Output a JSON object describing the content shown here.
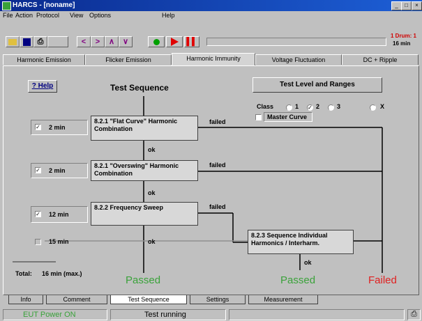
{
  "window": {
    "title": "HARCS - [noname]"
  },
  "menu": [
    "File",
    "Action",
    "Protocol",
    "View",
    "Options",
    "Help"
  ],
  "toolbar": {
    "status_lines": [
      "1 Drum: 1",
      "16   min"
    ],
    "record_color": "#00a000",
    "play_color": "#e00000"
  },
  "top_tabs": [
    "Harmonic Emission",
    "Flicker Emission",
    "Harmonic Immunity",
    "Voltage Fluctuation",
    "DC + Ripple"
  ],
  "active_top_tab": "Harmonic Immunity",
  "main": {
    "help_label": "? Help",
    "sequence_title": "Test Sequence",
    "level_button": "Test Level and Ranges",
    "class_label": "Class",
    "class_options": [
      "1",
      "2",
      "3",
      "X"
    ],
    "master_curve_label": "Master Curve",
    "steps": [
      {
        "time": "2 min",
        "label": "8.2.1 \"Flat Curve\" Harmonic Combination",
        "result_right": "failed",
        "result_down": "ok"
      },
      {
        "time": "2 min",
        "label": "8.2.1 \"Overswing\" Harmonic Combination",
        "result_right": "failed",
        "result_down": "ok"
      },
      {
        "time": "12 min",
        "label": "8.2.2 Frequency Sweep",
        "result_right": "failed",
        "result_down": "ok"
      },
      {
        "time": "15 min",
        "label": "8.2.3 Sequence Individual Harmonics / Interharm.",
        "result_right": "ok",
        "result_down": "ok"
      }
    ],
    "total_label": "Total:",
    "total_value": "16 min (max.)",
    "passed_label": "Passed",
    "failed_label": "Failed",
    "passed_color": "#3aa23a",
    "failed_color": "#e02020"
  },
  "bottom_tabs": [
    "Info",
    "Comment",
    "Test Sequence",
    "Settings",
    "Measurement"
  ],
  "active_bottom_tab": "Test Sequence",
  "status": {
    "eut": "EUT Power ON",
    "state": "Test running",
    "eut_color": "#3aa23a"
  }
}
